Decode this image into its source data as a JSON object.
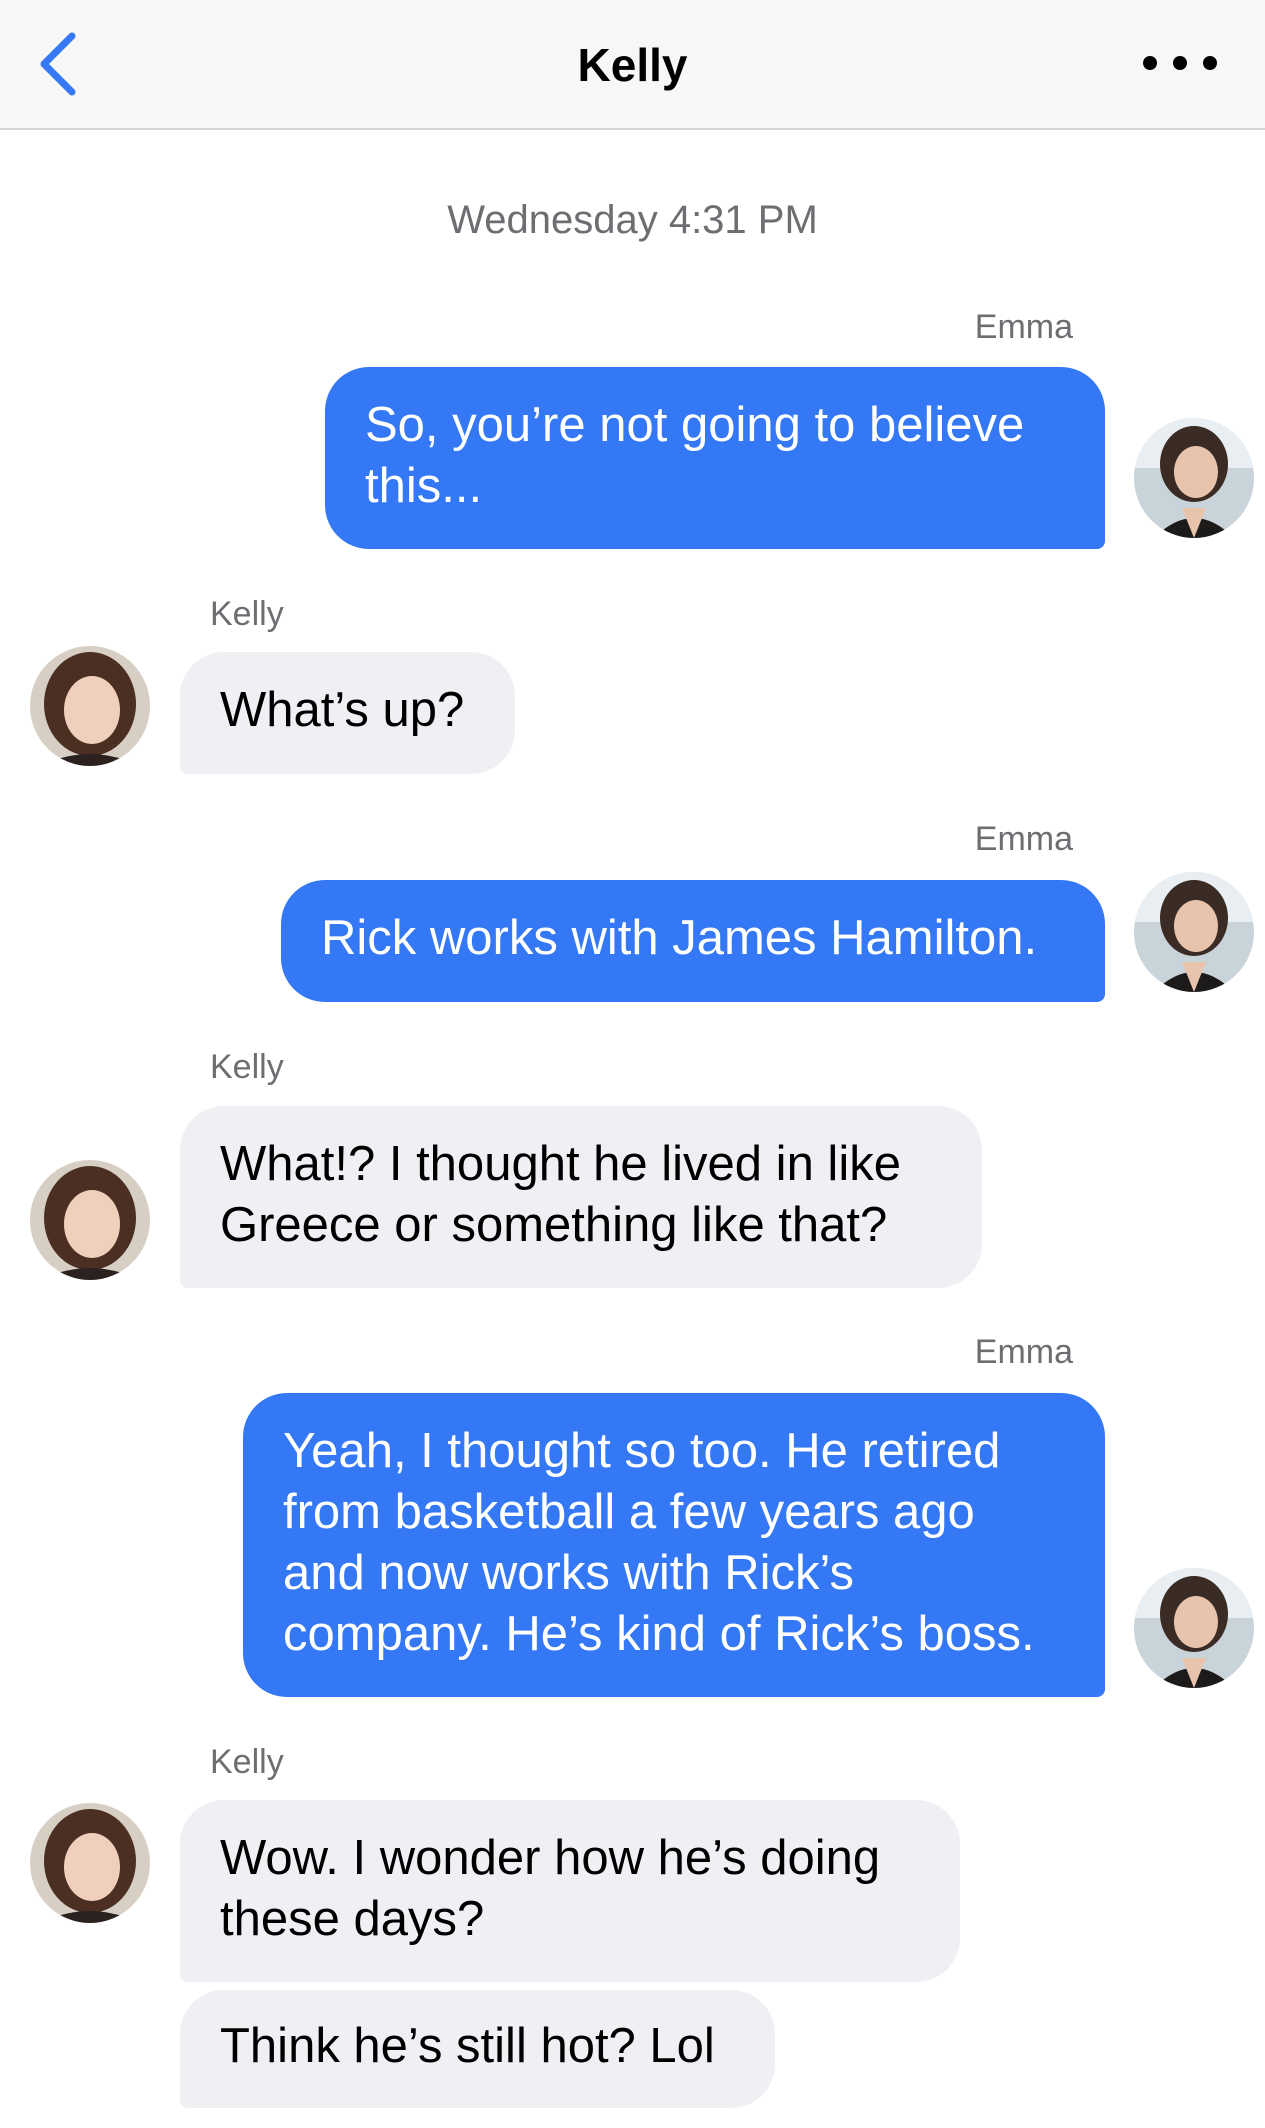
{
  "header": {
    "title": "Kelly",
    "back_icon": "chevron-left-icon",
    "more_icon": "ellipsis-icon"
  },
  "timestamp": "Wednesday 4:31 PM",
  "colors": {
    "outgoing_bubble": "#3478f6",
    "incoming_bubble": "#efeff4",
    "accent": "#3478f6"
  },
  "messages": [
    {
      "sender": "Emma",
      "direction": "outgoing",
      "lines": [
        "So, you’re not going to believe",
        "this..."
      ]
    },
    {
      "sender": "Kelly",
      "direction": "incoming",
      "lines": [
        "What’s up?"
      ]
    },
    {
      "sender": "Emma",
      "direction": "outgoing",
      "lines": [
        "Rick works with James Hamilton."
      ]
    },
    {
      "sender": "Kelly",
      "direction": "incoming",
      "lines": [
        "What!? I thought he lived in like",
        "Greece or something like that?"
      ]
    },
    {
      "sender": "Emma",
      "direction": "outgoing",
      "lines": [
        "Yeah, I thought so too. He retired",
        "from basketball a few years ago",
        "and now works with Rick’s",
        "company. He’s kind of Rick’s boss."
      ]
    },
    {
      "sender": "Kelly",
      "direction": "incoming",
      "lines": [
        "Wow. I wonder how he’s doing",
        "these days?"
      ]
    },
    {
      "sender": "Kelly",
      "direction": "incoming",
      "lines": [
        "Think he’s still hot? Lol"
      ]
    }
  ]
}
